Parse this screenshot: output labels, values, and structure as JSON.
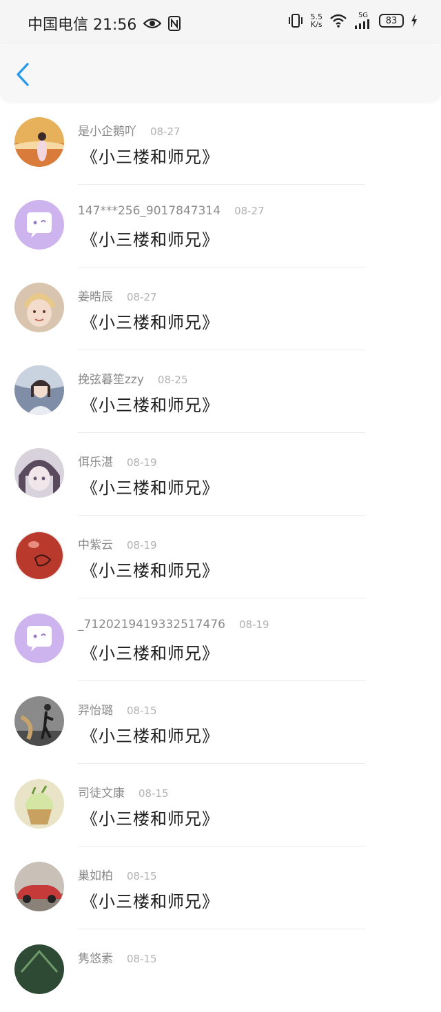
{
  "status_bar": {
    "carrier_time": "中国电信 21:56",
    "net_speed_value": "5.5",
    "net_speed_unit": "K/s",
    "signal_label": "5G",
    "battery": "83"
  },
  "items": [
    {
      "name": "是小企鹅吖",
      "date": "08-27",
      "content": "《小三楼和师兄》",
      "avatar_color": "#e7b05a"
    },
    {
      "name": "147***256_9017847314",
      "date": "08-27",
      "content": "《小三楼和师兄》",
      "avatar_color": "#cdb4ee"
    },
    {
      "name": "姜晧辰",
      "date": "08-27",
      "content": "《小三楼和师兄》",
      "avatar_color": "#e3c9b3"
    },
    {
      "name": "挽弦暮笙zzy",
      "date": "08-25",
      "content": "《小三楼和师兄》",
      "avatar_color": "#9aa8bd"
    },
    {
      "name": "佴乐湛",
      "date": "08-19",
      "content": "《小三楼和师兄》",
      "avatar_color": "#a89aa8"
    },
    {
      "name": "中紫云",
      "date": "08-19",
      "content": "《小三楼和师兄》",
      "avatar_color": "#b93a2c"
    },
    {
      "name": "_7120219419332517476",
      "date": "08-19",
      "content": "《小三楼和师兄》",
      "avatar_color": "#cdb4ee"
    },
    {
      "name": "羿怡璐",
      "date": "08-15",
      "content": "《小三楼和师兄》",
      "avatar_color": "#6d6d6d"
    },
    {
      "name": "司徒文康",
      "date": "08-15",
      "content": "《小三楼和师兄》",
      "avatar_color": "#d6d28c"
    },
    {
      "name": "巢如柏",
      "date": "08-15",
      "content": "《小三楼和师兄》",
      "avatar_color": "#c63a3a"
    },
    {
      "name": "隽悠素",
      "date": "08-15",
      "content": "",
      "avatar_color": "#2e4a34"
    }
  ]
}
